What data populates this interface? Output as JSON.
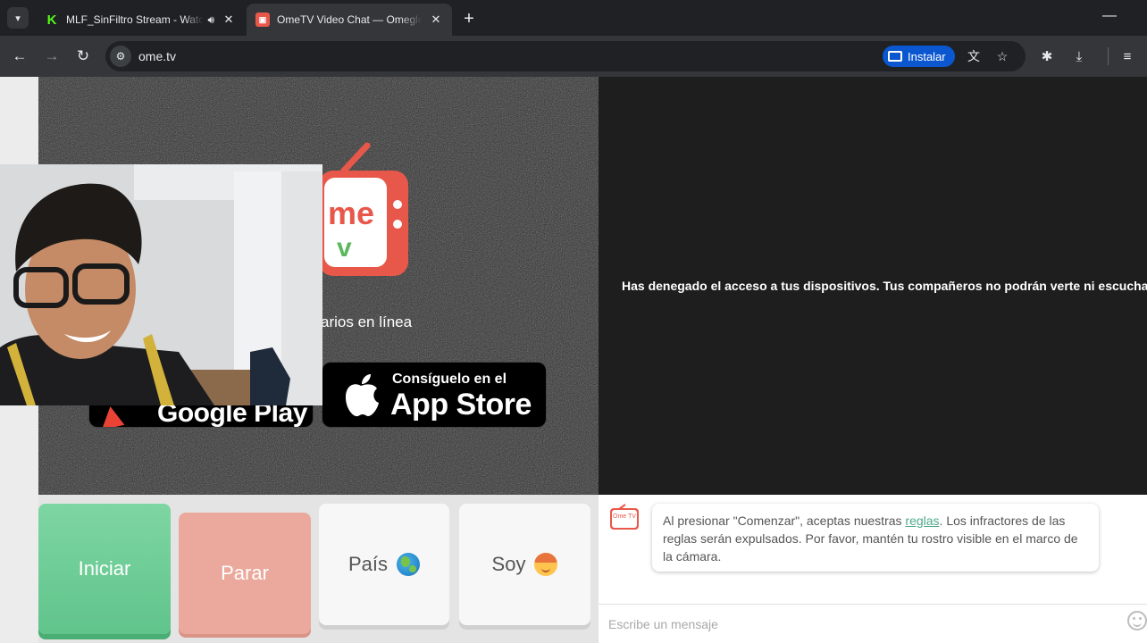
{
  "browser": {
    "tabs": [
      {
        "title": "MLF_SinFiltro Stream - Watch",
        "favicon": "kick-icon",
        "audio": true
      },
      {
        "title": "OmeTV Video Chat — Omegle Alternative",
        "favicon": "ometv-icon",
        "active": true
      }
    ],
    "url": "ome.tv",
    "install_label": "Instalar"
  },
  "page": {
    "online_text": "arios en línea",
    "google_play_label": "Google Play",
    "app_store_small": "Consíguelo en el",
    "app_store_big": "App Store",
    "denied_message": "Has denegado el acceso a tus dispositivos. Tus compañeros no podrán verte ni escucharte.",
    "logo_text": {
      "top": "me",
      "bottom": "v"
    }
  },
  "controls": {
    "start": "Iniciar",
    "stop": "Parar",
    "country": "País",
    "gender": "Soy"
  },
  "chat": {
    "avatar_text": "Ome TV",
    "notice_pre": "Al presionar \"Comenzar\", aceptas nuestras ",
    "notice_link": "reglas",
    "notice_post": ". Los infractores de las reglas serán expulsados. Por favor, mantén tu rostro visible en el marco de la cámara.",
    "input_placeholder": "Escribe un mensaje"
  },
  "colors": {
    "start": "#6fcf97",
    "stop": "#eaa99c",
    "accent": "#0b57d0",
    "link": "#4fa88a"
  }
}
